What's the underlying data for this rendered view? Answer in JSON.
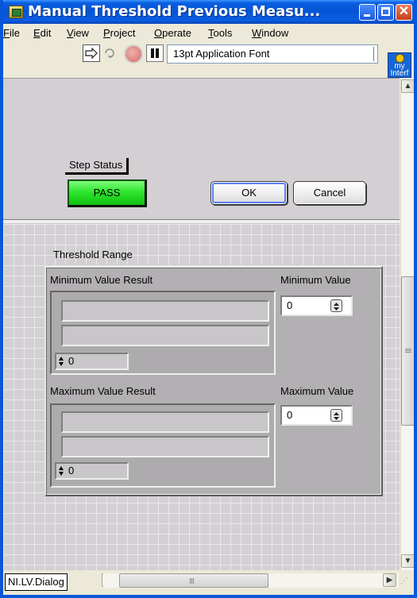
{
  "window": {
    "title": "Manual Threshold Previous Measu...",
    "icon": "labview-vi-icon"
  },
  "menu": [
    "File",
    "Edit",
    "View",
    "Project",
    "Operate",
    "Tools",
    "Window"
  ],
  "toolbar": {
    "font": "13pt Application Font",
    "icons": [
      "run-arrow-icon",
      "run-continuously-icon",
      "abort-icon",
      "pause-icon"
    ]
  },
  "interface_icon": {
    "line1": "my",
    "line2": "Interf"
  },
  "step_status": {
    "label": "Step Status",
    "value": "PASS",
    "color": "#29e029"
  },
  "buttons": {
    "ok": "OK",
    "cancel": "Cancel"
  },
  "threshold": {
    "title": "Threshold Range",
    "min_result_label": "Minimum Value Result",
    "min_value_label": "Minimum Value",
    "min_index": "0",
    "min_value": "0",
    "max_result_label": "Maximum Value Result",
    "max_value_label": "Maximum Value",
    "max_index": "0",
    "max_value": "0"
  },
  "statusbar": {
    "context": "NI.LV.Dialog"
  }
}
